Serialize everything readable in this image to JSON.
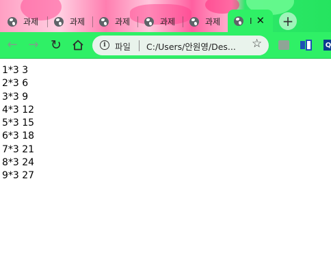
{
  "tabs": [
    {
      "title": "과제"
    },
    {
      "title": "과제"
    },
    {
      "title": "과제"
    },
    {
      "title": "과제"
    },
    {
      "title": "과제"
    },
    {
      "title": "I",
      "active": true
    }
  ],
  "toolbar": {
    "back_icon": "back-arrow-icon",
    "forward_icon": "forward-arrow-icon",
    "reload_icon": "reload-icon",
    "home_icon": "home-icon"
  },
  "omnibox": {
    "scheme_label": "파일",
    "url": "C:/Users/안원영/Des..."
  },
  "extensions": [
    {
      "label": "",
      "icon": "extension-gray-icon"
    },
    {
      "label": "",
      "icon": "extension-blue-icon"
    },
    {
      "label": "Q",
      "icon": "extension-q-icon"
    }
  ],
  "content": {
    "lines": [
      "1*3 3",
      "2*3 6",
      "3*3 9",
      "4*3 12",
      "5*3 15",
      "6*3 18",
      "7*3 21",
      "8*3 24",
      "9*3 27"
    ]
  },
  "colors": {
    "toolbar": "#2ff066",
    "active_tab": "#2ff066",
    "omnibox": "#e9f3ec"
  }
}
